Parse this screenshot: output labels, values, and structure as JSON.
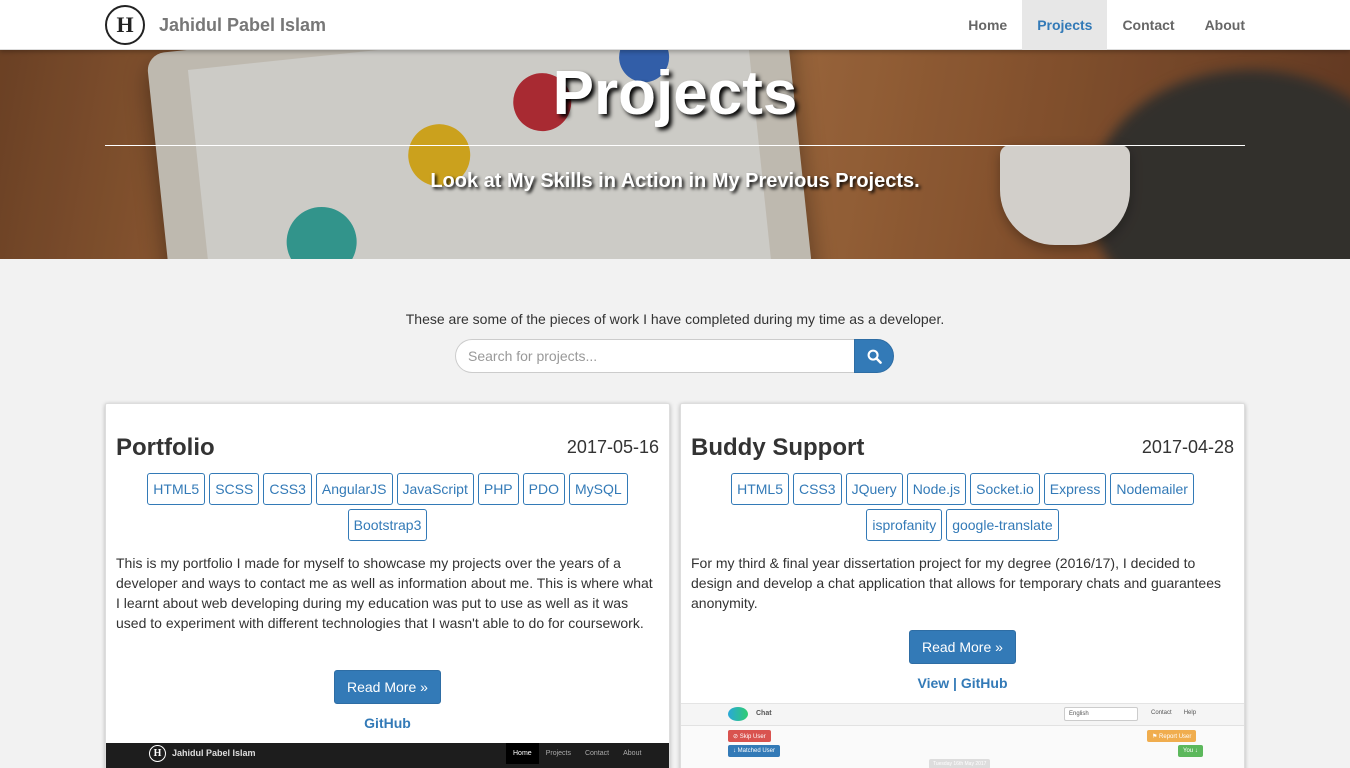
{
  "navbar": {
    "logo_letter": "H",
    "brand": "Jahidul Pabel Islam",
    "items": [
      {
        "label": "Home",
        "active": false
      },
      {
        "label": "Projects",
        "active": true
      },
      {
        "label": "Contact",
        "active": false
      },
      {
        "label": "About",
        "active": false
      }
    ]
  },
  "hero": {
    "title": "Projects",
    "subtitle": "Look at My Skills in Action in My Previous Projects."
  },
  "intro": "These are some of the pieces of work I have completed during my time as a developer.",
  "search": {
    "placeholder": "Search for projects...",
    "button_icon": "search-icon"
  },
  "projects": [
    {
      "title": "Portfolio",
      "date": "2017-05-16",
      "tags": [
        "HTML5",
        "SCSS",
        "CSS3",
        "AngularJS",
        "JavaScript",
        "PHP",
        "PDO",
        "MySQL",
        "Bootstrap3"
      ],
      "description": "This is my portfolio I made for myself to showcase my projects over the years of a developer and ways to contact me as well as information about me. This is where what I learnt about web developing during my education was put to use as well as it was used to experiment with different technologies that I wasn't able to do for coursework.",
      "read_more": "Read More »",
      "links": [
        "GitHub"
      ],
      "preview": {
        "brand": "Jahidul Pabel Islam",
        "nav": [
          "Home",
          "Projects",
          "Contact",
          "About"
        ]
      }
    },
    {
      "title": "Buddy Support",
      "date": "2017-04-28",
      "tags": [
        "HTML5",
        "CSS3",
        "JQuery",
        "Node.js",
        "Socket.io",
        "Express",
        "Nodemailer",
        "isprofanity",
        "google-translate"
      ],
      "description": "For my third & final year dissertation project for my degree (2016/17), I decided to design and develop a chat application that allows for temporary chats and guarantees anonymity.",
      "read_more": "Read More »",
      "links": [
        "View",
        "GitHub"
      ],
      "preview": {
        "brand": "Chat",
        "language": "English",
        "nav": [
          "Contact",
          "Help"
        ],
        "skip_user": "⊘ Skip User",
        "matched_user": "↓ Matched User",
        "report_user": "⚑ Report User",
        "you": "You ↓",
        "date": "Tuesday 16th May 2017"
      }
    }
  ],
  "colors": {
    "primary": "#337ab7",
    "page_bg": "#f2f2f2",
    "nav_active_bg": "#e7e7e7"
  }
}
